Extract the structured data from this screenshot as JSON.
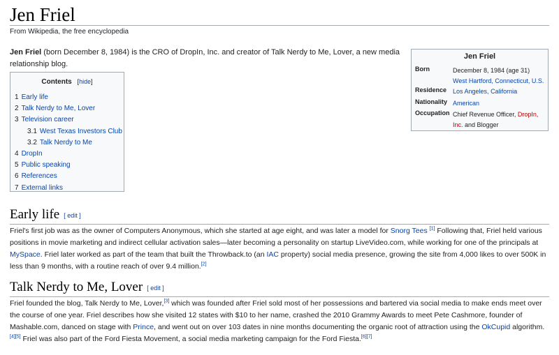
{
  "title": "Jen Friel",
  "tagline": "From Wikipedia, the free encyclopedia",
  "intro": {
    "name": "Jen Friel",
    "text": " (born December 8, 1984) is the CRO of DropIn, Inc. and creator of Talk Nerdy to Me, Lover, a new media relationship blog."
  },
  "toc": {
    "title": "Contents",
    "hide_open": "[",
    "hide_label": "hide",
    "hide_close": "]",
    "items": [
      {
        "num": "1",
        "label": "Early life"
      },
      {
        "num": "2",
        "label": "Talk Nerdy to Me, Lover"
      },
      {
        "num": "3",
        "label": "Television career"
      },
      {
        "num": "3.1",
        "label": "West Texas Investors Club"
      },
      {
        "num": "3.2",
        "label": "Talk Nerdy to Me"
      },
      {
        "num": "4",
        "label": "DropIn"
      },
      {
        "num": "5",
        "label": "Public speaking"
      },
      {
        "num": "6",
        "label": "References"
      },
      {
        "num": "7",
        "label": "External links"
      }
    ]
  },
  "infobox": {
    "title": "Jen Friel",
    "born_label": "Born",
    "born_date": "December 8, 1984 (age 31)",
    "born_place_1": "West Hartford",
    "born_sep": ", ",
    "born_place_2": "Connecticut",
    "born_place_3": ", U.S.",
    "residence_label": "Residence",
    "residence_1": "Los Angeles",
    "residence_sep": ", ",
    "residence_2": "California",
    "nationality_label": "Nationality",
    "nationality": "American",
    "occupation_label": "Occupation",
    "occupation_text": "Chief Revenue Officer, ",
    "occupation_link_a": "DropIn,",
    "occupation_link_b": "Inc.",
    "occupation_tail": " and Blogger"
  },
  "early_life": {
    "heading": "Early life",
    "edit": "[ edit ]",
    "p1": "Friel's first job was as the owner of Computers Anonymous, which she started at age eight, and was later a model for ",
    "snorg": "Snorg Tees",
    "ref1": "[1]",
    "p2": " Following that, Friel held various positions in movie marketing and indirect cellular activation sales—later becoming a personality on startup LiveVideo.com, while working for one of the principals at ",
    "myspace": "MySpace",
    "p3": ". Friel later worked as part of the team that built the Throwback.to (an ",
    "iac": "IAC",
    "p4": " property) social media presence, growing the site from 4,000 likes to over 500K in less than 9 months, with a routine reach of over 9.4 million.",
    "ref2": "[2]"
  },
  "talk_nerdy": {
    "heading": "Talk Nerdy to Me, Lover",
    "edit": "[ edit ]",
    "p1": "Friel founded the blog, Talk Nerdy to Me, Lover,",
    "ref3": "[3]",
    "p2": " which was founded after Friel sold most of her possessions and bartered via social media to make ends meet over the course of one year. Friel describes how she visited 12 states with $10 to her name, crashed the 2010 Grammy Awards to meet Pete Cashmore, founder of Mashable.com, danced on stage with ",
    "prince": "Prince",
    "p3": ", and went out on over 103 dates in nine months documenting the organic root of attraction using the ",
    "okcupid": "OkCupid",
    "p4": " algorithm.",
    "ref45": "[4][5]",
    "p5": " Friel was also part of the Ford Fiesta Movement, a social media marketing campaign for the Ford Fiesta.",
    "ref67": "[6][7]"
  }
}
